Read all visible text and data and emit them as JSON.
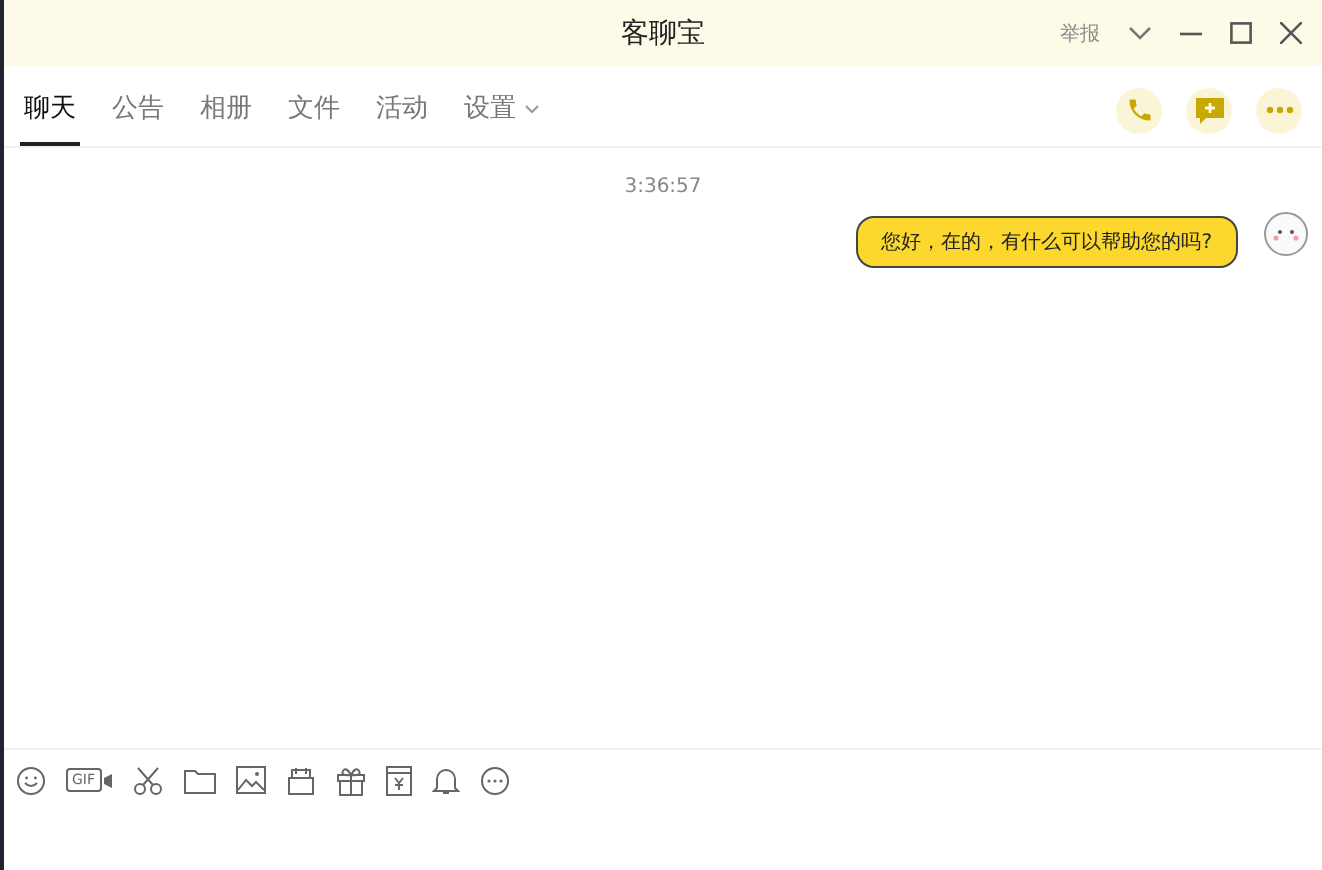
{
  "window": {
    "title": "客聊宝",
    "report_link": "举报"
  },
  "tabs": [
    {
      "label": "聊天",
      "selected": true,
      "menu": false
    },
    {
      "label": "公告",
      "selected": false,
      "menu": false
    },
    {
      "label": "相册",
      "selected": false,
      "menu": false
    },
    {
      "label": "文件",
      "selected": false,
      "menu": false
    },
    {
      "label": "活动",
      "selected": false,
      "menu": false
    },
    {
      "label": "设置",
      "selected": false,
      "menu": true
    }
  ],
  "messages": [
    {
      "time": "3:36:57",
      "text": "您好，在的，有什么可以帮助您的吗?"
    }
  ],
  "toolbar": {
    "gif_label": "GIF"
  }
}
